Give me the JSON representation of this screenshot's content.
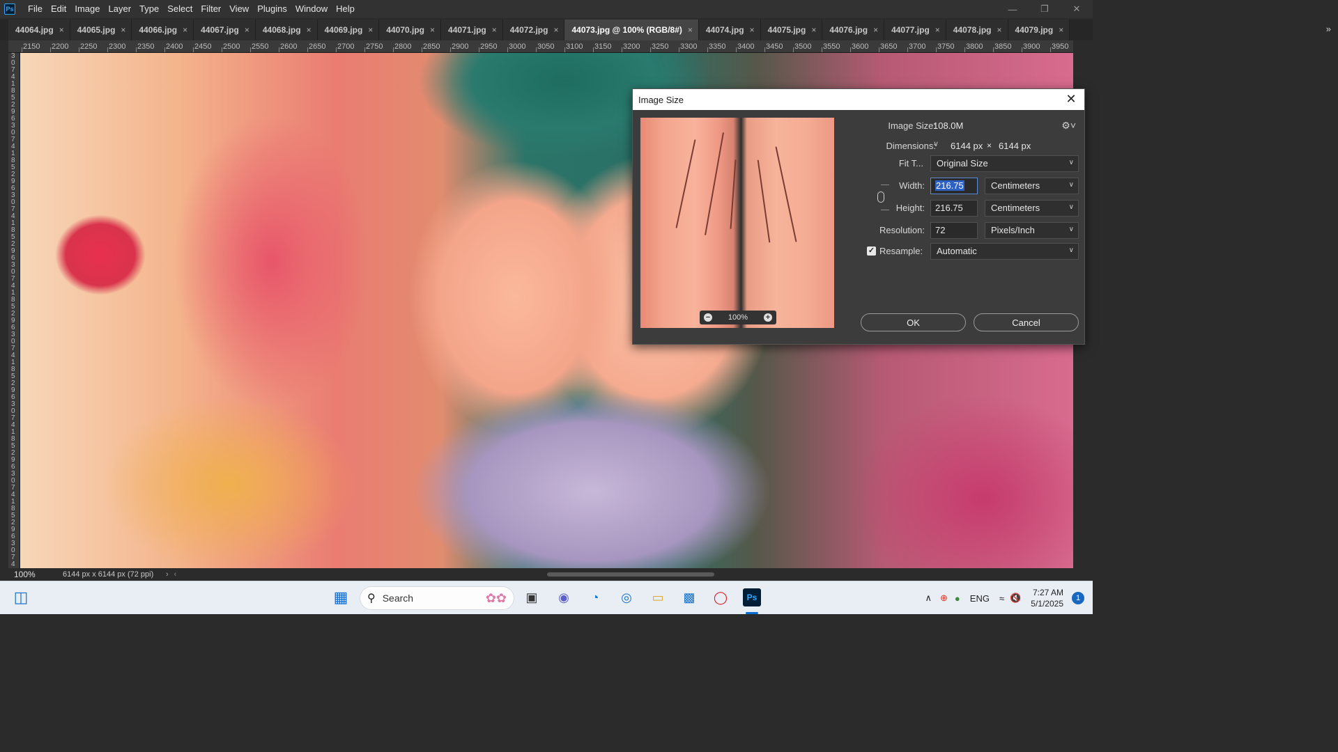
{
  "app": {
    "logo": "Ps",
    "menu": [
      "File",
      "Edit",
      "Image",
      "Layer",
      "Type",
      "Select",
      "Filter",
      "View",
      "Plugins",
      "Window",
      "Help"
    ]
  },
  "tabs": [
    {
      "label": "44064.jpg",
      "active": false
    },
    {
      "label": "44065.jpg",
      "active": false
    },
    {
      "label": "44066.jpg",
      "active": false
    },
    {
      "label": "44067.jpg",
      "active": false
    },
    {
      "label": "44068.jpg",
      "active": false
    },
    {
      "label": "44069.jpg",
      "active": false
    },
    {
      "label": "44070.jpg",
      "active": false
    },
    {
      "label": "44071.jpg",
      "active": false
    },
    {
      "label": "44072.jpg",
      "active": false
    },
    {
      "label": "44073.jpg @ 100% (RGB/8#)",
      "active": true
    },
    {
      "label": "44074.jpg",
      "active": false
    },
    {
      "label": "44075.jpg",
      "active": false
    },
    {
      "label": "44076.jpg",
      "active": false
    },
    {
      "label": "44077.jpg",
      "active": false
    },
    {
      "label": "44078.jpg",
      "active": false
    },
    {
      "label": "44079.jpg",
      "active": false
    }
  ],
  "tab_close_glyph": "×",
  "tab_more_glyph": "»",
  "ruler": {
    "horizontal": [
      "2150",
      "2200",
      "2250",
      "2300",
      "2350",
      "2400",
      "2450",
      "2500",
      "2550",
      "2600",
      "2650",
      "2700",
      "2750",
      "2800",
      "2850",
      "2900",
      "2950",
      "3000",
      "3050",
      "3100",
      "3150",
      "3200",
      "3250",
      "3300",
      "3350",
      "3400",
      "3450",
      "3500",
      "3550",
      "3600",
      "3650",
      "3700",
      "3750",
      "3800",
      "3850",
      "3900",
      "3950"
    ]
  },
  "dialog": {
    "title": "Image Size",
    "preview_zoom": "100%",
    "image_size_label": "Image Size:",
    "image_size_value": "108.0M",
    "dimensions_label": "Dimensions:",
    "dimensions_w": "6144 px",
    "dimensions_x": "×",
    "dimensions_h": "6144 px",
    "fit_label": "Fit T...",
    "fit_value": "Original Size",
    "width_label": "Width:",
    "width_value": "216.75",
    "width_unit": "Centimeters",
    "height_label": "Height:",
    "height_value": "216.75",
    "height_unit": "Centimeters",
    "resolution_label": "Resolution:",
    "resolution_value": "72",
    "resolution_unit": "Pixels/Inch",
    "resample_label": "Resample:",
    "resample_checked": true,
    "resample_value": "Automatic",
    "ok_label": "OK",
    "cancel_label": "Cancel"
  },
  "status": {
    "zoom": "100%",
    "doc_info": "6144 px x 6144 px (72 ppi)"
  },
  "taskbar": {
    "search_label": "Search",
    "language": "ENG",
    "time": "7:27 AM",
    "date": "5/1/2025",
    "notifications": "1"
  }
}
